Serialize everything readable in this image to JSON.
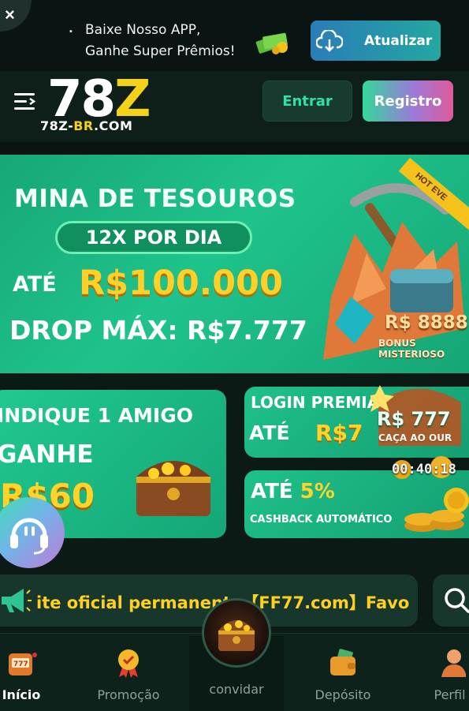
{
  "topbar": {
    "close_label": "×",
    "promo_line1": "Baixe Nosso APP,",
    "promo_line2": "Ganhe Super Prêmios!",
    "update_label": "Atualizar"
  },
  "header": {
    "logo_main_digits": "78",
    "logo_main_letter": "Z",
    "logo_sub_prefix": "78Z-",
    "logo_sub_highlight": "BR",
    "logo_sub_suffix": ".COM",
    "login_label": "Entrar",
    "register_label": "Registro"
  },
  "hero": {
    "title": "MINA DE TESOUROS",
    "pill": "12X POR DIA",
    "ate": "ATÉ",
    "amount": "R$100.000",
    "drop": "DROP MÁX: R$7.777",
    "hot_badge": "HOT EVE",
    "bonus_amount": "R$ 8888",
    "bonus_label": "BONUS MISTERIOSO"
  },
  "cards": {
    "invite": {
      "line1": "INDIQUE 1 AMIGO",
      "line2": "GANHE",
      "amount": "R$60"
    },
    "login": {
      "line1": "LOGIN PREMIA",
      "ate": "ATÉ",
      "amount": "R$7"
    },
    "cashback": {
      "ate": "ATÉ",
      "percent": "5%",
      "line2": "CASHBACK AUTOMÁTICO"
    }
  },
  "float_widget": {
    "amount": "R$ 777",
    "label": "CAÇA AO OUR",
    "timer": "00:40:18"
  },
  "marquee": {
    "text": "ite oficial permanente【FF77.com】Favo"
  },
  "bottom_nav": {
    "items": [
      {
        "label": "Início",
        "icon": "slot-machine-icon",
        "active": true
      },
      {
        "label": "Promoção",
        "icon": "medal-icon",
        "active": false
      },
      {
        "label": "convidar",
        "icon": "treasure-chest-icon",
        "active": false
      },
      {
        "label": "Depósito",
        "icon": "wallet-icon",
        "active": false
      },
      {
        "label": "Perfil",
        "icon": "user-icon",
        "active": false
      }
    ]
  },
  "colors": {
    "accent_green": "#1fc38c",
    "gold": "#ffd42a",
    "background": "#0c1a16"
  }
}
